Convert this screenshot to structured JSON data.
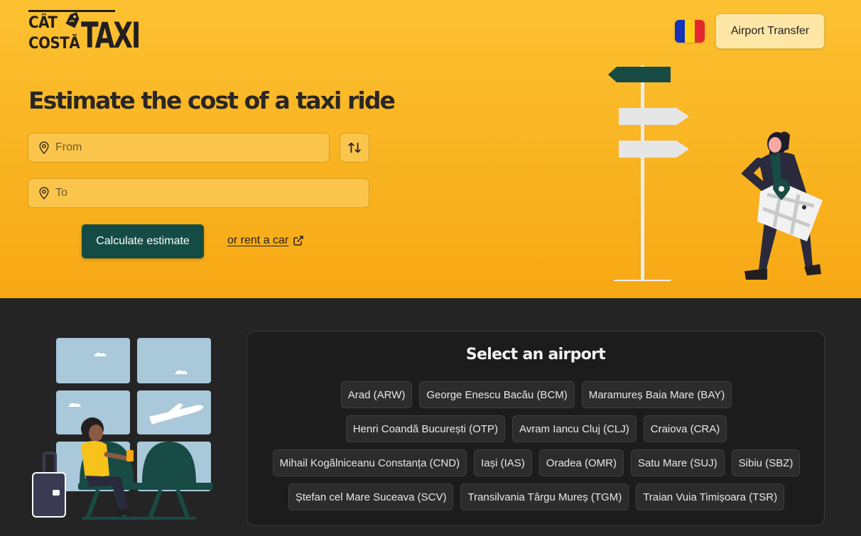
{
  "brand": {
    "line1": "CÂT",
    "line2": "COSTĂ",
    "word": "TAXI",
    "tag_icon": "price-tag-icon"
  },
  "header": {
    "language_flag": "romania-flag-icon",
    "flag_colors": [
      "#1533b8",
      "#fcd116",
      "#e5282e"
    ],
    "airport_transfer_label": "Airport Transfer"
  },
  "hero": {
    "title": "Estimate the cost of a taxi ride",
    "from_placeholder": "From",
    "from_value": "",
    "to_placeholder": "To",
    "to_value": "",
    "swap_icon": "swap-arrows-icon",
    "calculate_label": "Calculate estimate",
    "rent_link_label": "or rent a car",
    "rent_link_icon": "external-link-icon"
  },
  "airports": {
    "title": "Select an airport",
    "items": [
      "Arad (ARW)",
      "George Enescu Bacău (BCM)",
      "Maramureș Baia Mare (BAY)",
      "Henri Coandă București (OTP)",
      "Avram Iancu Cluj (CLJ)",
      "Craiova (CRA)",
      "Mihail Kogălniceanu Constanța (CND)",
      "Iași (IAS)",
      "Oradea (OMR)",
      "Satu Mare (SUJ)",
      "Sibiu (SBZ)",
      "Ștefan cel Mare Suceava (SCV)",
      "Transilvania Târgu Mureș (TGM)",
      "Traian Vuia Timișoara (TSR)"
    ]
  },
  "colors": {
    "hero_yellow": "#fcc131",
    "accent_green": "#144c45",
    "dark_bg": "#242424"
  }
}
